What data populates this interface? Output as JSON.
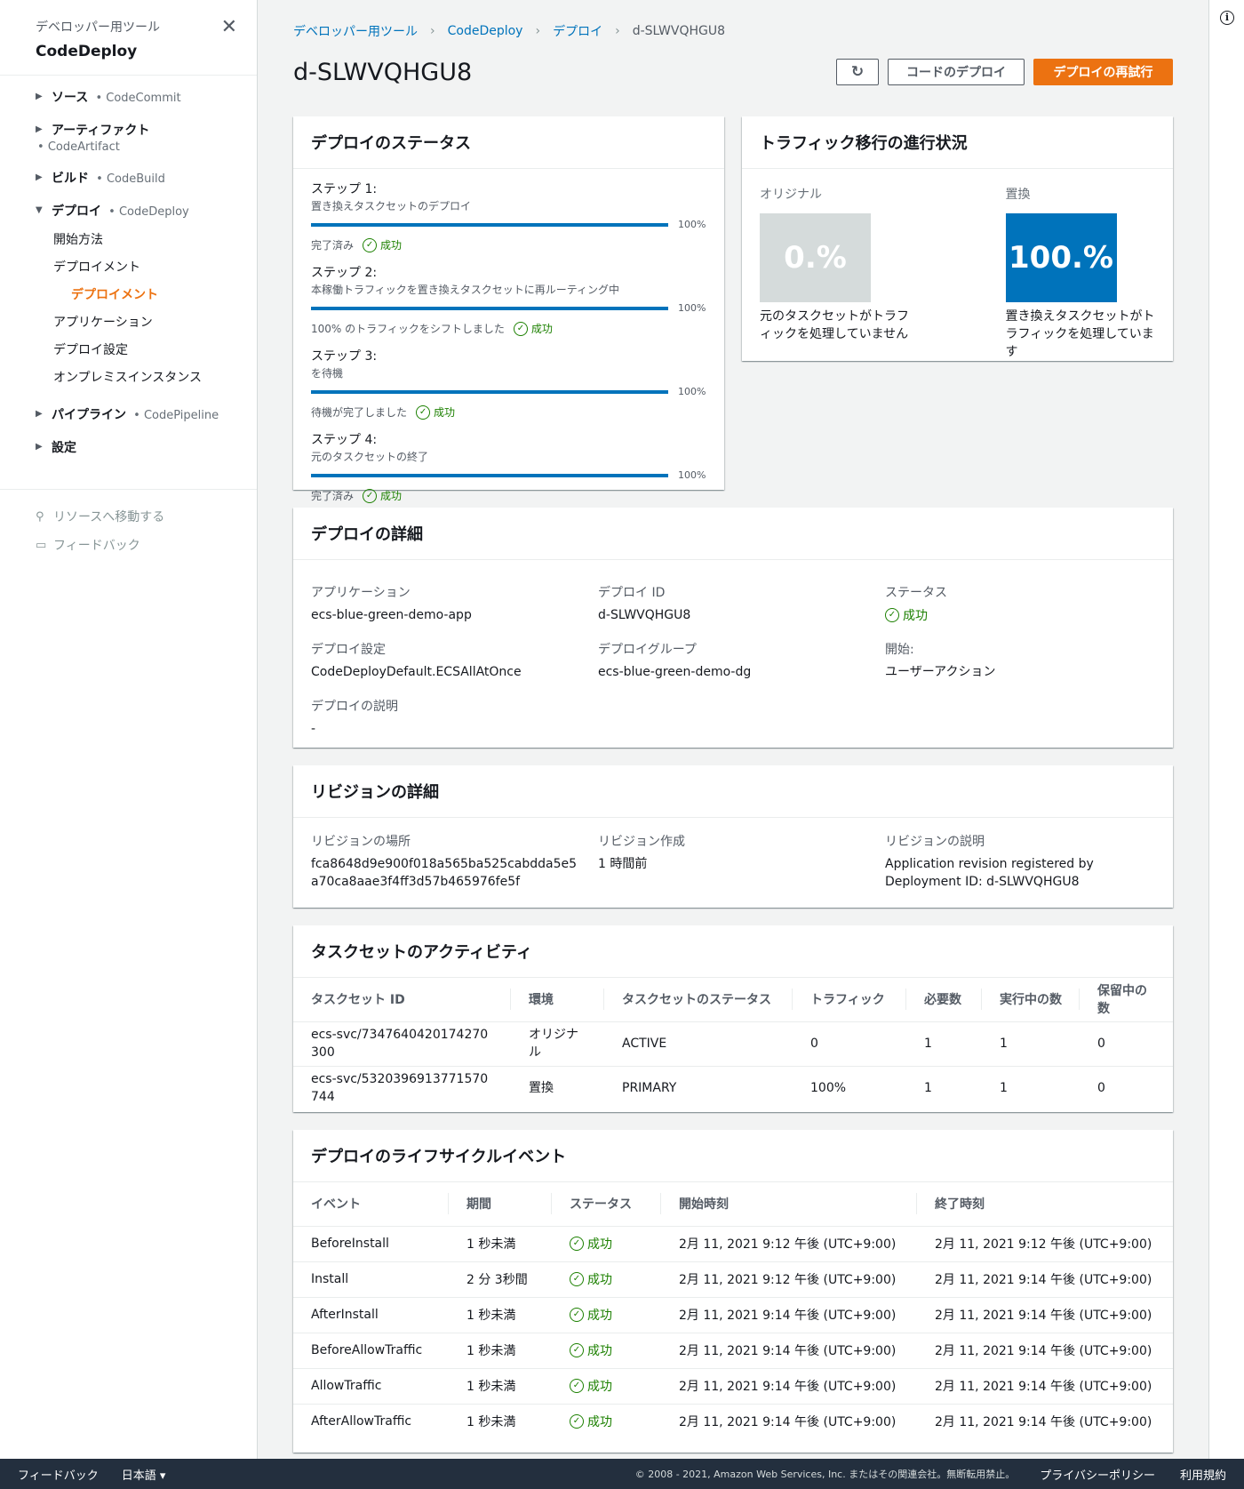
{
  "sidebar": {
    "kicker": "デベロッパー用ツール",
    "title": "CodeDeploy",
    "groups": [
      {
        "label": "ソース",
        "sub": "CodeCommit"
      },
      {
        "label": "アーティファクト",
        "sub": "CodeArtifact"
      },
      {
        "label": "ビルド",
        "sub": "CodeBuild"
      },
      {
        "label": "デプロイ",
        "sub": "CodeDeploy"
      },
      {
        "label": "パイプライン",
        "sub": "CodePipeline"
      },
      {
        "label": "設定",
        "sub": ""
      }
    ],
    "deploy_items": [
      "開始方法",
      "デプロイメント",
      "デプロイメント",
      "アプリケーション",
      "デプロイ設定",
      "オンプレミスインスタンス"
    ],
    "tools": {
      "goto": "リソースへ移動する",
      "feedback": "フィードバック"
    }
  },
  "breadcrumb": [
    "デベロッパー用ツール",
    "CodeDeploy",
    "デプロイ",
    "d-SLWVQHGU8"
  ],
  "page": {
    "title": "d-SLWVQHGU8",
    "btn_deploy_code": "コードのデプロイ",
    "btn_retry": "デプロイの再試行"
  },
  "status_panel": {
    "title": "デプロイのステータス",
    "success": "成功",
    "steps": [
      {
        "title": "ステップ 1:",
        "desc": "置き換えタスクセットのデプロイ",
        "progress": 100,
        "pct_label": "100%",
        "status": "完了済み"
      },
      {
        "title": "ステップ 2:",
        "desc": "本稼働トラフィックを置き換えタスクセットに再ルーティング中",
        "progress": 100,
        "pct_label": "100%",
        "status": "100% のトラフィックをシフトしました"
      },
      {
        "title": "ステップ 3:",
        "desc": "を待機",
        "progress": 100,
        "pct_label": "100%",
        "status": "待機が完了しました"
      },
      {
        "title": "ステップ 4:",
        "desc": "元のタスクセットの終了",
        "progress": 100,
        "pct_label": "100%",
        "status": "完了済み"
      }
    ]
  },
  "traffic_panel": {
    "title": "トラフィック移行の進行状況",
    "original": {
      "label": "オリジナル",
      "value": "0.%",
      "desc": "元のタスクセットがトラフィックを処理していません",
      "color": "#d5dbdb"
    },
    "replacement": {
      "label": "置換",
      "value": "100.%",
      "desc": "置き換えタスクセットがトラフィックを処理しています",
      "color": "#0073bb"
    }
  },
  "detail_panel": {
    "title": "デプロイの詳細",
    "application_k": "アプリケーション",
    "application_v": "ecs-blue-green-demo-app",
    "deploy_id_k": "デプロイ ID",
    "deploy_id_v": "d-SLWVQHGU8",
    "status_k": "ステータス",
    "status_v": "成功",
    "config_k": "デプロイ設定",
    "config_v": "CodeDeployDefault.ECSAllAtOnce",
    "group_k": "デプロイグループ",
    "group_v": "ecs-blue-green-demo-dg",
    "start_k": "開始:",
    "start_v": "ユーザーアクション",
    "desc_k": "デプロイの説明",
    "desc_v": "-"
  },
  "revision_panel": {
    "title": "リビジョンの詳細",
    "loc_k": "リビジョンの場所",
    "loc_v": "fca8648d9e900f018a565ba525cabdda5e5a70ca8aae3f4ff3d57b465976fe5f",
    "created_k": "リビジョン作成",
    "created_v": "1 時間前",
    "desc_k": "リビジョンの説明",
    "desc_v": "Application revision registered by Deployment ID: d-SLWVQHGU8"
  },
  "taskset_panel": {
    "title": "タスクセットのアクティビティ",
    "headers": [
      "タスクセット ID",
      "環境",
      "タスクセットのステータス",
      "トラフィック",
      "必要数",
      "実行中の数",
      "保留中の数"
    ],
    "rows": [
      [
        "ecs-svc/7347640420174270300",
        "オリジナル",
        "ACTIVE",
        "0",
        "1",
        "1",
        "0"
      ],
      [
        "ecs-svc/5320396913771570744",
        "置換",
        "PRIMARY",
        "100%",
        "1",
        "1",
        "0"
      ]
    ]
  },
  "lifecycle_panel": {
    "title": "デプロイのライフサイクルイベント",
    "headers": [
      "イベント",
      "期間",
      "ステータス",
      "開始時刻",
      "終了時刻"
    ],
    "rows": [
      [
        "BeforeInstall",
        "1 秒未満",
        "成功",
        "2月 11, 2021 9:12 午後 (UTC+9:00)",
        "2月 11, 2021 9:12 午後 (UTC+9:00)"
      ],
      [
        "Install",
        "2 分 3秒間",
        "成功",
        "2月 11, 2021 9:12 午後 (UTC+9:00)",
        "2月 11, 2021 9:14 午後 (UTC+9:00)"
      ],
      [
        "AfterInstall",
        "1 秒未満",
        "成功",
        "2月 11, 2021 9:14 午後 (UTC+9:00)",
        "2月 11, 2021 9:14 午後 (UTC+9:00)"
      ],
      [
        "BeforeAllowTraffic",
        "1 秒未満",
        "成功",
        "2月 11, 2021 9:14 午後 (UTC+9:00)",
        "2月 11, 2021 9:14 午後 (UTC+9:00)"
      ],
      [
        "AllowTraffic",
        "1 秒未満",
        "成功",
        "2月 11, 2021 9:14 午後 (UTC+9:00)",
        "2月 11, 2021 9:14 午後 (UTC+9:00)"
      ],
      [
        "AfterAllowTraffic",
        "1 秒未満",
        "成功",
        "2月 11, 2021 9:14 午後 (UTC+9:00)",
        "2月 11, 2021 9:14 午後 (UTC+9:00)"
      ]
    ]
  },
  "footer": {
    "feedback": "フィードバック",
    "language": "日本語",
    "copyright": "© 2008 - 2021, Amazon Web Services, Inc. またはその関連会社。無断転用禁止。",
    "privacy": "プライバシーポリシー",
    "terms": "利用規約"
  },
  "colors": {
    "accent": "#ec7211",
    "link": "#0073bb",
    "success": "#1d8102"
  }
}
